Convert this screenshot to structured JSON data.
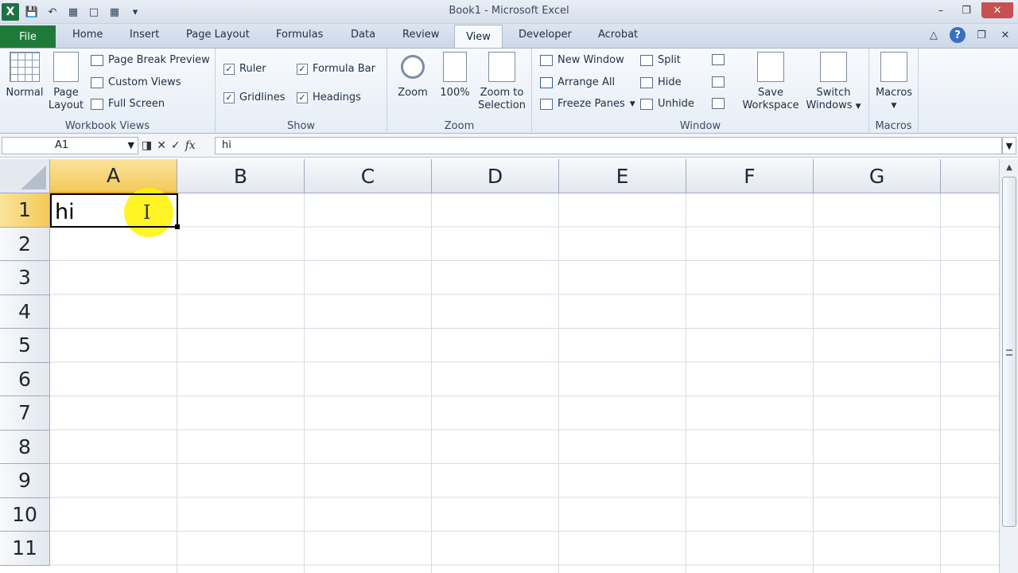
{
  "window": {
    "title": "Book1 - Microsoft Excel"
  },
  "qat": {
    "logo": "X",
    "icons": [
      "save-icon",
      "undo-icon",
      "print-preview-icon",
      "new-icon",
      "grid-icon",
      "customize-icon"
    ]
  },
  "tabs": {
    "file": "File",
    "home": "Home",
    "insert": "Insert",
    "page_layout": "Page Layout",
    "formulas": "Formulas",
    "data": "Data",
    "review": "Review",
    "view": "View",
    "developer": "Developer",
    "acrobat": "Acrobat"
  },
  "ribbon": {
    "workbook_views": {
      "label": "Workbook Views",
      "normal": "Normal",
      "page_layout_1": "Page",
      "page_layout_2": "Layout",
      "page_break_preview": "Page Break Preview",
      "custom_views": "Custom Views",
      "full_screen": "Full Screen"
    },
    "show": {
      "label": "Show",
      "ruler": "Ruler",
      "formula_bar": "Formula Bar",
      "gridlines": "Gridlines",
      "headings": "Headings"
    },
    "zoom": {
      "label": "Zoom",
      "zoom": "Zoom",
      "zoom_100": "100%",
      "zoom_selection_1": "Zoom to",
      "zoom_selection_2": "Selection"
    },
    "window": {
      "label": "Window",
      "new_window": "New Window",
      "arrange_all": "Arrange All",
      "freeze_panes": "Freeze Panes",
      "split": "Split",
      "hide": "Hide",
      "unhide": "Unhide",
      "save_workspace_1": "Save",
      "save_workspace_2": "Workspace",
      "switch_windows_1": "Switch",
      "switch_windows_2": "Windows"
    },
    "macros": {
      "label": "Macros",
      "macros": "Macros"
    }
  },
  "formula_bar": {
    "name_box": "A1",
    "content": "hi"
  },
  "columns": [
    "A",
    "B",
    "C",
    "D",
    "E",
    "F",
    "G"
  ],
  "rows": [
    "1",
    "2",
    "3",
    "4",
    "5",
    "6",
    "7",
    "8",
    "9",
    "10",
    "11"
  ],
  "cells": {
    "A1": "hi"
  },
  "selection": {
    "cell": "A1"
  }
}
